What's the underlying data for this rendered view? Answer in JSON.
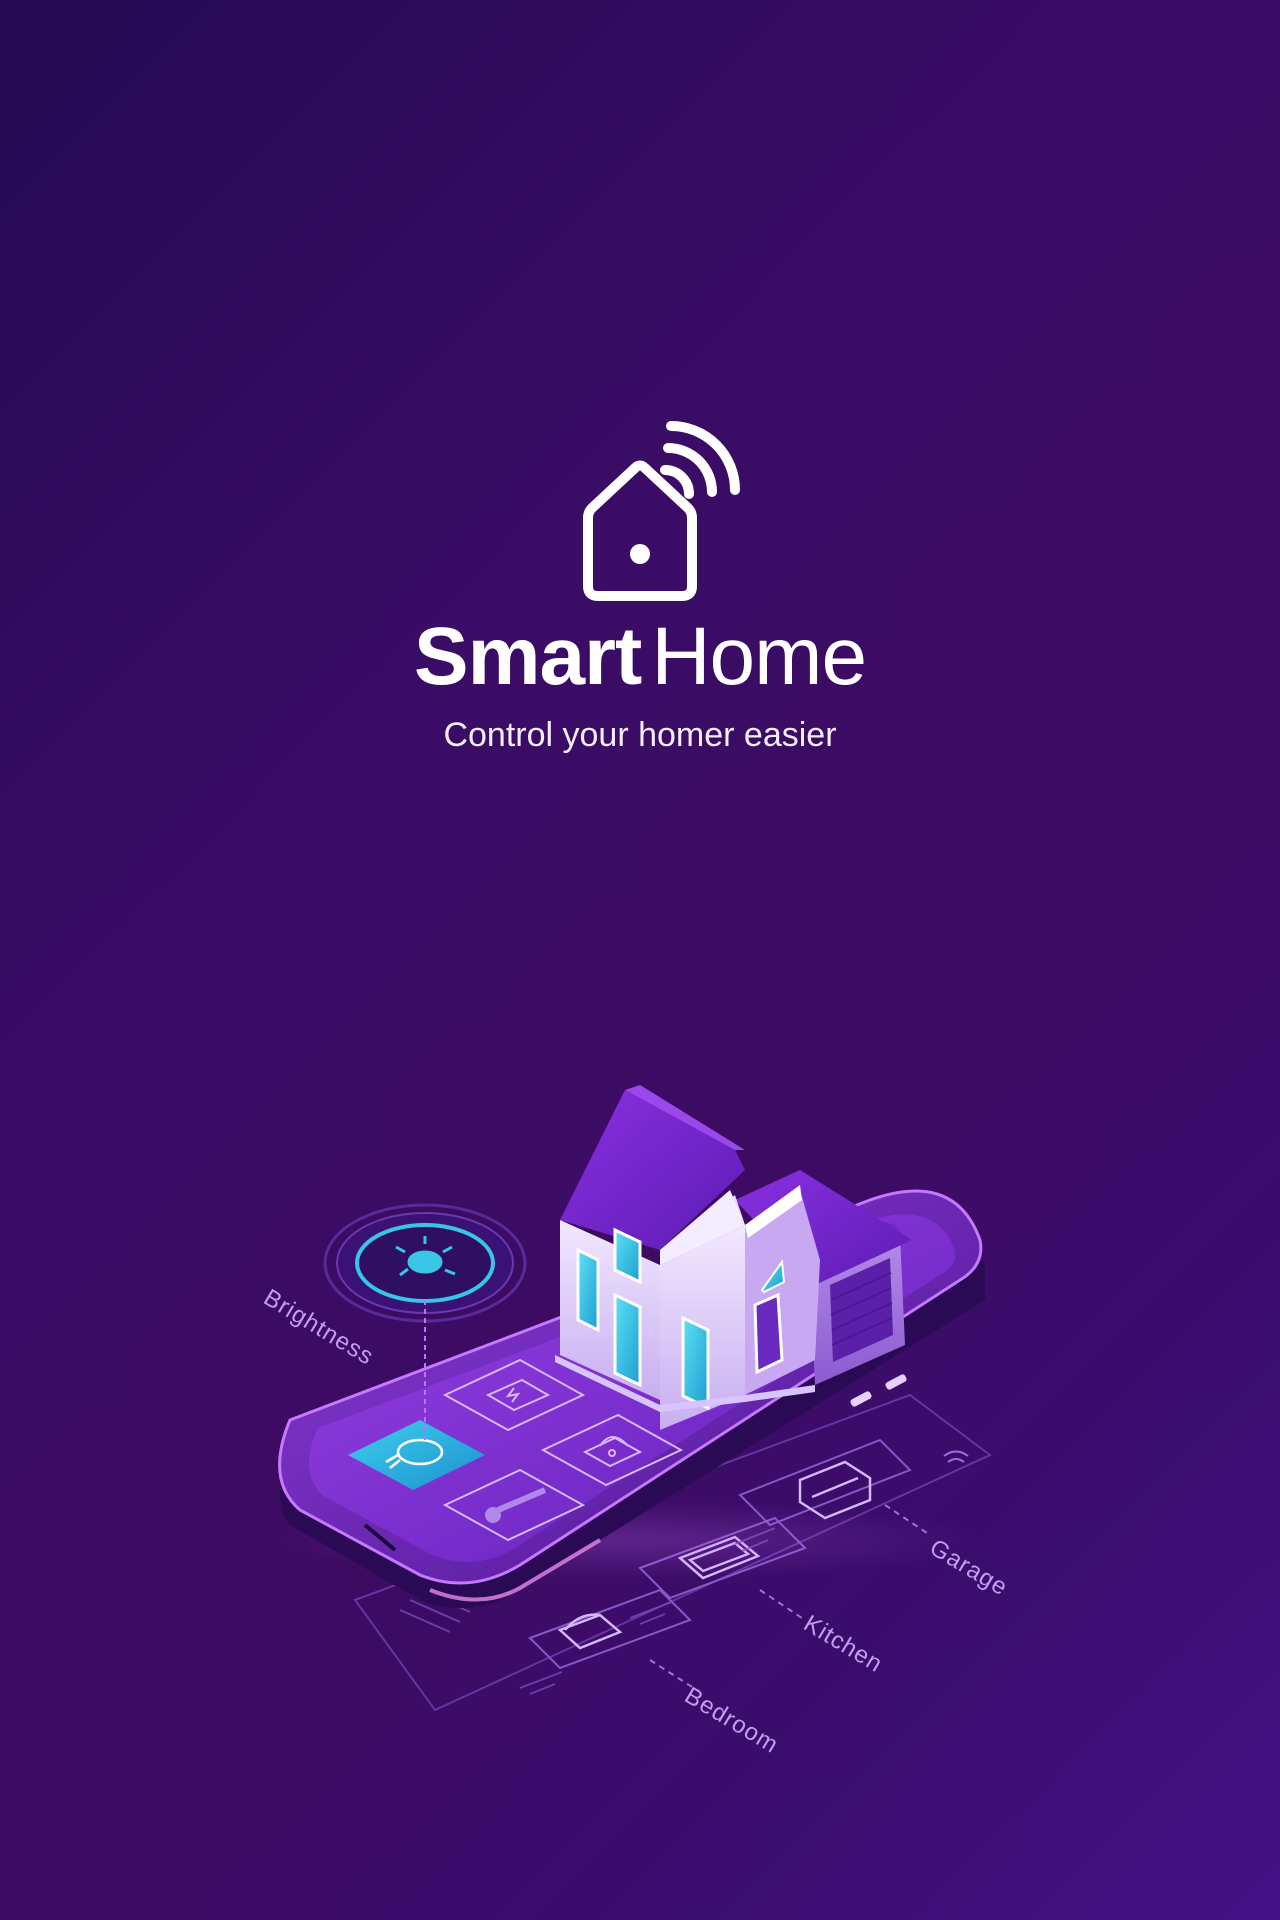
{
  "brand": {
    "title_bold": "Smart",
    "title_light": "Home",
    "tagline": "Control your homer easier"
  },
  "labels": {
    "brightness": "Brightness",
    "garage": "Garage",
    "kitchen": "Kitchen",
    "bedroom": "Bedroom"
  },
  "icons": {
    "logo": "house-wifi-icon",
    "app_tiles": [
      "lightbulb-icon",
      "battery-icon",
      "lock-icon",
      "thermometer-icon"
    ],
    "rooms": [
      "garage-icon",
      "oven-icon",
      "bed-icon"
    ],
    "brightness_dial": "lightbulb-icon"
  },
  "colors": {
    "background": "#3a0c66",
    "accent_cyan": "#35c8e8",
    "accent_purple": "#8a2be2",
    "text": "#ffffff"
  }
}
